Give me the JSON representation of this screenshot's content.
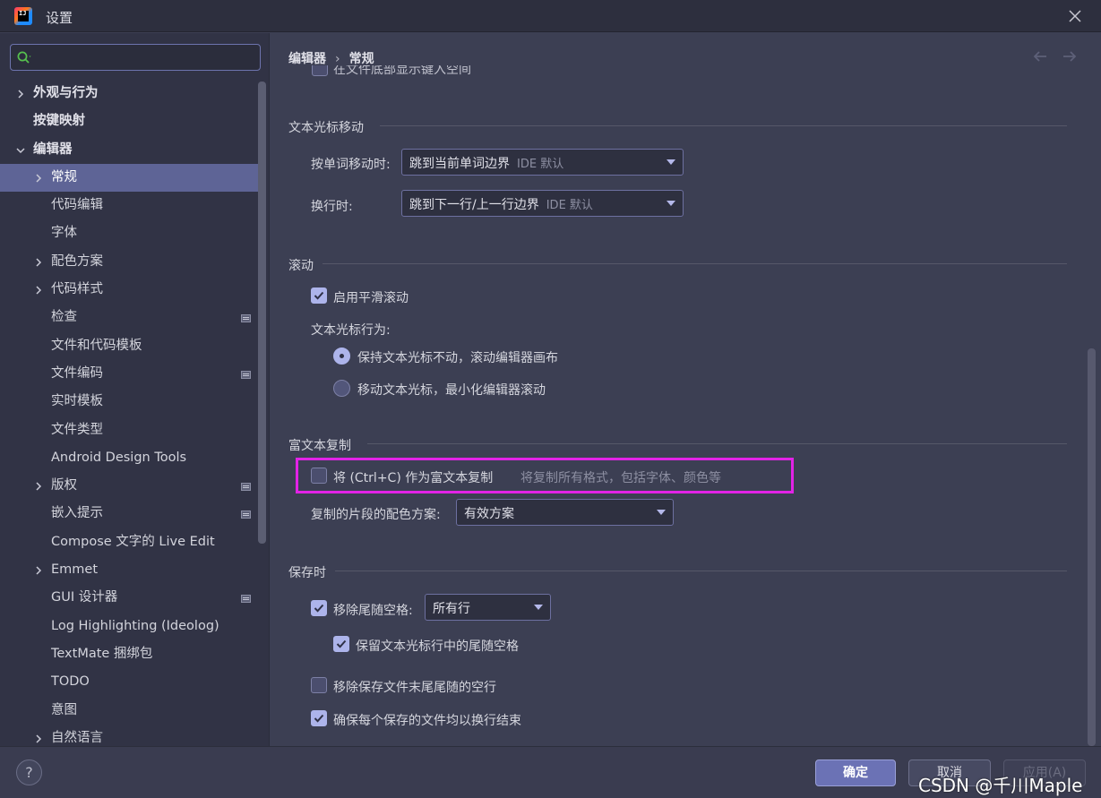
{
  "window": {
    "title": "设置",
    "logo_text": "IJ"
  },
  "search": {
    "placeholder": ""
  },
  "sidebar": {
    "items": [
      {
        "label": "外观与行为",
        "level": 0,
        "expandable": true,
        "expanded": false,
        "bold": true
      },
      {
        "label": "按键映射",
        "level": 0,
        "expandable": false,
        "bold": true
      },
      {
        "label": "编辑器",
        "level": 0,
        "expandable": true,
        "expanded": true,
        "bold": true
      },
      {
        "label": "常规",
        "level": 1,
        "expandable": true,
        "expanded": false,
        "selected": true
      },
      {
        "label": "代码编辑",
        "level": 1,
        "expandable": false
      },
      {
        "label": "字体",
        "level": 1,
        "expandable": false
      },
      {
        "label": "配色方案",
        "level": 1,
        "expandable": true,
        "expanded": false
      },
      {
        "label": "代码样式",
        "level": 1,
        "expandable": true,
        "expanded": false
      },
      {
        "label": "检查",
        "level": 1,
        "expandable": false,
        "project_icon": true
      },
      {
        "label": "文件和代码模板",
        "level": 1,
        "expandable": false
      },
      {
        "label": "文件编码",
        "level": 1,
        "expandable": false,
        "project_icon": true
      },
      {
        "label": "实时模板",
        "level": 1,
        "expandable": false
      },
      {
        "label": "文件类型",
        "level": 1,
        "expandable": false
      },
      {
        "label": "Android Design Tools",
        "level": 1,
        "expandable": false
      },
      {
        "label": "版权",
        "level": 1,
        "expandable": true,
        "expanded": false,
        "project_icon": true
      },
      {
        "label": "嵌入提示",
        "level": 1,
        "expandable": false,
        "project_icon": true
      },
      {
        "label": "Compose 文字的 Live Edit",
        "level": 1,
        "expandable": false
      },
      {
        "label": "Emmet",
        "level": 1,
        "expandable": true,
        "expanded": false
      },
      {
        "label": "GUI 设计器",
        "level": 1,
        "expandable": false,
        "project_icon": true
      },
      {
        "label": "Log Highlighting (Ideolog)",
        "level": 1,
        "expandable": false
      },
      {
        "label": "TextMate 捆绑包",
        "level": 1,
        "expandable": false
      },
      {
        "label": "TODO",
        "level": 1,
        "expandable": false
      },
      {
        "label": "意图",
        "level": 1,
        "expandable": false
      },
      {
        "label": "自然语言",
        "level": 1,
        "expandable": true,
        "expanded": false
      }
    ]
  },
  "breadcrumb": {
    "parent": "编辑器",
    "separator": "›",
    "current": "常规"
  },
  "content": {
    "cut_off_row": {
      "label": "在文件底部显示键入空间",
      "checked": false
    },
    "caret_movement": {
      "title": "文本光标移动",
      "word_label": "按单词移动时:",
      "word_value": "跳到当前单词边界",
      "word_hint": "IDE 默认",
      "line_label": "换行时:",
      "line_value": "跳到下一行/上一行边界",
      "line_hint": "IDE 默认"
    },
    "scrolling": {
      "title": "滚动",
      "smooth_label": "启用平滑滚动",
      "smooth_checked": true,
      "caret_behavior_label": "文本光标行为:",
      "radio1_label": "保持文本光标不动，滚动编辑器画布",
      "radio1_selected": true,
      "radio2_label": "移动文本光标，最小化编辑器滚动",
      "radio2_selected": false
    },
    "rich_copy": {
      "title": "富文本复制",
      "copy_label": "将 (Ctrl+C) 作为富文本复制",
      "copy_checked": false,
      "copy_hint": "将复制所有格式，包括字体、颜色等",
      "scheme_label": "复制的片段的配色方案:",
      "scheme_value": "有效方案"
    },
    "on_save": {
      "title": "保存时",
      "strip_label": "移除尾随空格:",
      "strip_checked": true,
      "strip_value": "所有行",
      "keep_caret_label": "保留文本光标行中的尾随空格",
      "keep_caret_checked": true,
      "remove_blank_label": "移除保存文件末尾尾随的空行",
      "remove_blank_checked": false,
      "ensure_newline_label": "确保每个保存的文件均以换行结束",
      "ensure_newline_checked": true
    }
  },
  "buttons": {
    "help": "?",
    "ok": "确定",
    "cancel": "取消",
    "apply": "应用(A)"
  },
  "watermark": "CSDN @千川Maple",
  "colors": {
    "accent": "#6b72b5",
    "selection": "#5e6496",
    "highlight_box": "#e223e6",
    "checkbox_on": "#adb4eb"
  }
}
